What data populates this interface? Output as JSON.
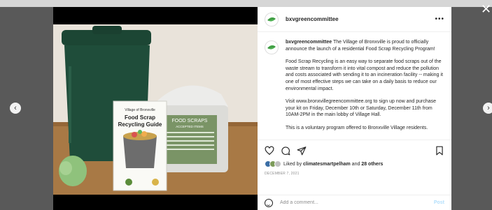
{
  "post": {
    "username": "bxvgreencommittee",
    "more_icon": "more-horizontal-icon",
    "caption": {
      "username": "bxvgreencommittee",
      "paragraph_1": "The Village of Bronxville is proud to officially announce the launch of a residential Food Scrap Recycling Program!",
      "paragraph_2": "Food Scrap Recycling is an easy way to separate food scraps out of the waste stream to transform it into vital compost and reduce the pollution and costs associated with sending it to an incineration facility -- making it one of most effective steps we can take on a daily basis to reduce our environmental impact.",
      "paragraph_3": "Visit www.bronxvillegreencommittee.org to sign up now and purchase your kit on Friday, December 10th or Saturday, December 11th from 10AM-2PM in the main lobby of Village Hall.",
      "paragraph_4": "This is a voluntary program offered to Bronxville Village residents."
    },
    "likes_prefix": "Liked by ",
    "liked_by": "climatesmartpelham",
    "likes_middle": " and ",
    "others": "28 others",
    "date": "DECEMBER 7, 2021",
    "comment_placeholder": "Add a comment...",
    "post_label": "Post"
  },
  "photo": {
    "booklet_line1": "Village of Bronxville",
    "booklet_line2": "Food Scrap",
    "booklet_line3": "Recycling Guide",
    "bin_label_title": "FOOD SCRAPS",
    "bin_label_sub": "ACCEPTED ITEMS"
  },
  "navigation": {
    "prev_glyph": "‹",
    "next_glyph": "›",
    "close_glyph": "✕"
  },
  "colors": {
    "backdrop": "#595959",
    "bin_green": "#1f4d3a",
    "link_blue": "#b2dffc",
    "brand_green": "#4caf50"
  }
}
